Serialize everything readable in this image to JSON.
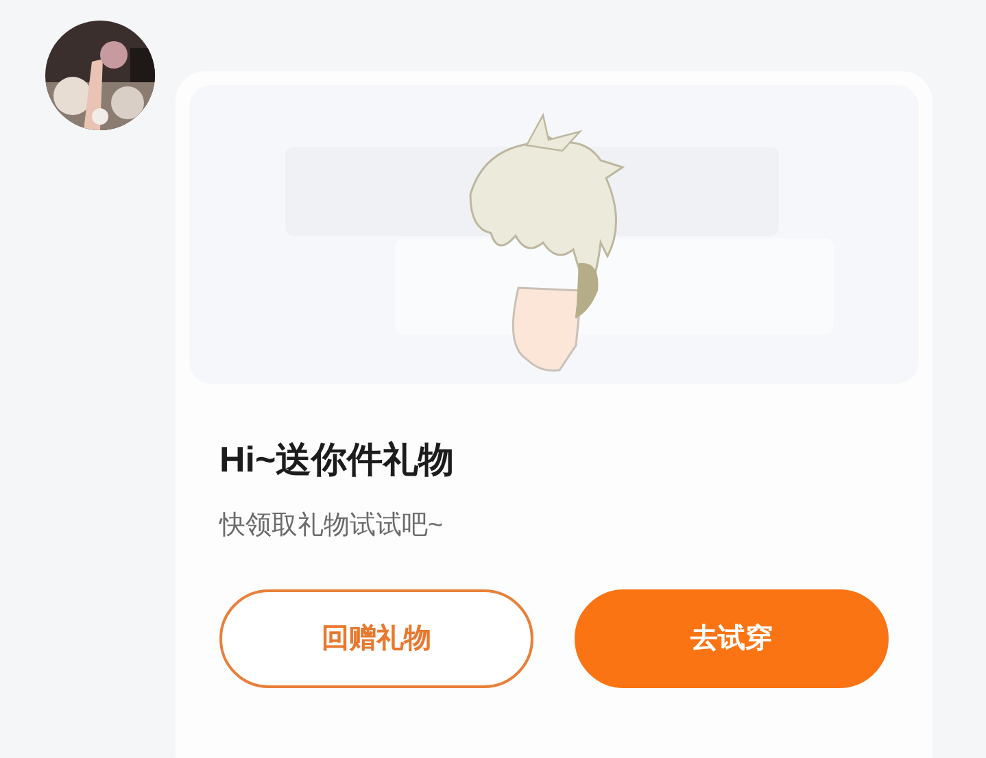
{
  "card": {
    "title": "Hi~送你件礼物",
    "subtitle": "快领取礼物试试吧~",
    "buttons": [
      {
        "label": "回赠礼物",
        "kind": "outline"
      },
      {
        "label": "去试穿",
        "kind": "filled"
      }
    ]
  }
}
